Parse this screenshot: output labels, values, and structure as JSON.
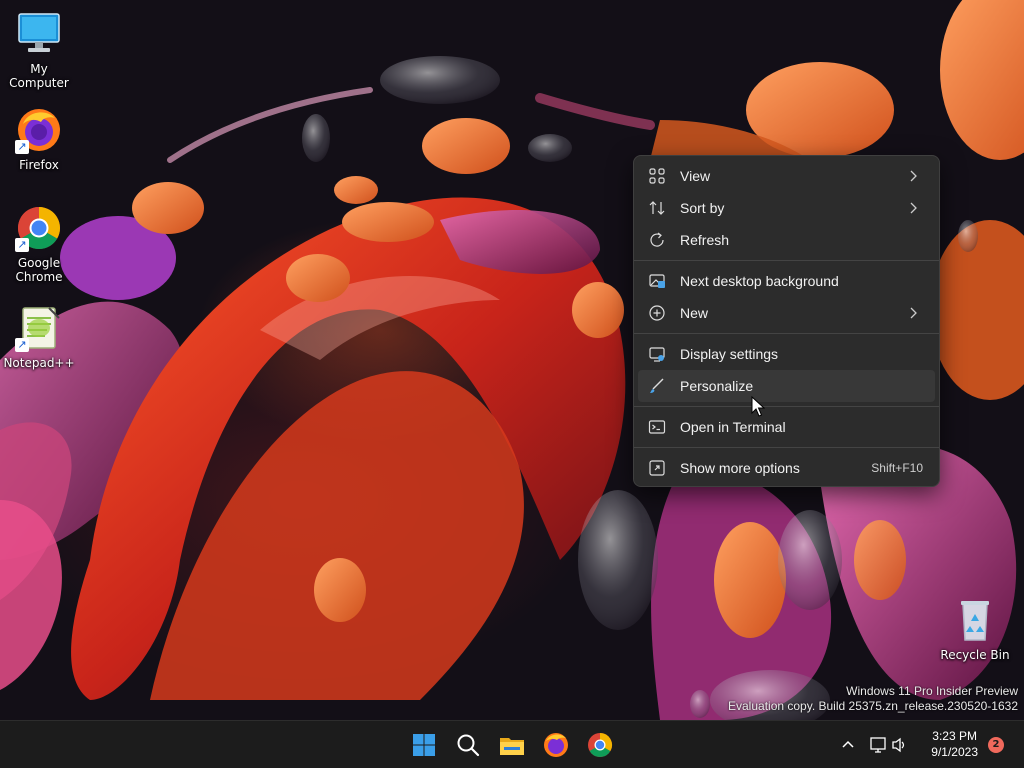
{
  "desktop": {
    "icons": [
      {
        "label": "My Computer"
      },
      {
        "label": "Firefox"
      },
      {
        "label": "Google Chrome"
      },
      {
        "label": "Notepad++"
      },
      {
        "label": "Recycle Bin"
      }
    ]
  },
  "context_menu": {
    "items": [
      {
        "label": "View",
        "icon": "grid-view-icon",
        "submenu": true
      },
      {
        "label": "Sort by",
        "icon": "sort-icon",
        "submenu": true
      },
      {
        "label": "Refresh",
        "icon": "refresh-icon"
      },
      {
        "label": "Next desktop background",
        "icon": "next-background-icon"
      },
      {
        "label": "New",
        "icon": "plus-circle-icon",
        "submenu": true
      },
      {
        "label": "Display settings",
        "icon": "display-settings-icon"
      },
      {
        "label": "Personalize",
        "icon": "brush-icon",
        "hovered": true
      },
      {
        "label": "Open in Terminal",
        "icon": "terminal-icon"
      },
      {
        "label": "Show more options",
        "icon": "more-options-icon",
        "shortcut": "Shift+F10"
      }
    ]
  },
  "watermark": {
    "line1": "Windows 11 Pro Insider Preview",
    "line2": "Evaluation copy. Build 25375.zn_release.230520-1632"
  },
  "taskbar": {
    "apps": [
      "start-icon",
      "search-icon",
      "file-explorer-icon",
      "firefox-icon",
      "chrome-icon"
    ],
    "clock_time": "3:23 PM",
    "clock_date": "9/1/2023",
    "notification_count": "2"
  },
  "colors": {
    "menu_bg": "#2c2c2c",
    "taskbar_bg": "#1c1c1c",
    "badge": "#f0695c",
    "start_blue": "#3a9ee8"
  }
}
